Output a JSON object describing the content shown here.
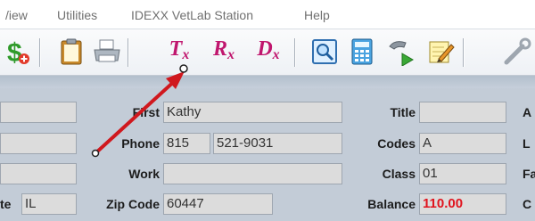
{
  "menu": {
    "items": [
      "/iew",
      "Utilities",
      "IDEXX VetLab Station",
      "Help"
    ]
  },
  "toolbar": {
    "tx": "T",
    "tx_sub": "x",
    "rx": "R",
    "rx_sub": "x",
    "dx": "D",
    "dx_sub": "x",
    "icons": [
      "dollar-add-icon",
      "clipboard-icon",
      "printer-icon",
      "treatment-icon",
      "prescription-icon",
      "diagnosis-icon",
      "preview-icon",
      "calculator-icon",
      "phone-call-icon",
      "notepad-edit-icon",
      "tool-icon"
    ]
  },
  "form": {
    "first_label": "First",
    "first_value": "Kathy",
    "phone_label": "Phone",
    "phone_area": "815",
    "phone_number": "521-9031",
    "work_label": "Work",
    "work_value": "",
    "zip_label": "Zip Code",
    "zip_value": "60447",
    "state_label": "te",
    "state_value": "IL",
    "title_label": "Title",
    "title_value": "",
    "codes_label": "Codes",
    "codes_value": "A",
    "class_label": "Class",
    "class_value": "01",
    "balance_label": "Balance",
    "balance_value": "110.00",
    "right_cut_1": "A",
    "right_cut_2": "L",
    "right_cut_3": "Fa",
    "right_cut_4": "C"
  },
  "colors": {
    "accent_rx": "#c0166e",
    "balance_red": "#e0141e",
    "arrow_red": "#d0181e"
  }
}
